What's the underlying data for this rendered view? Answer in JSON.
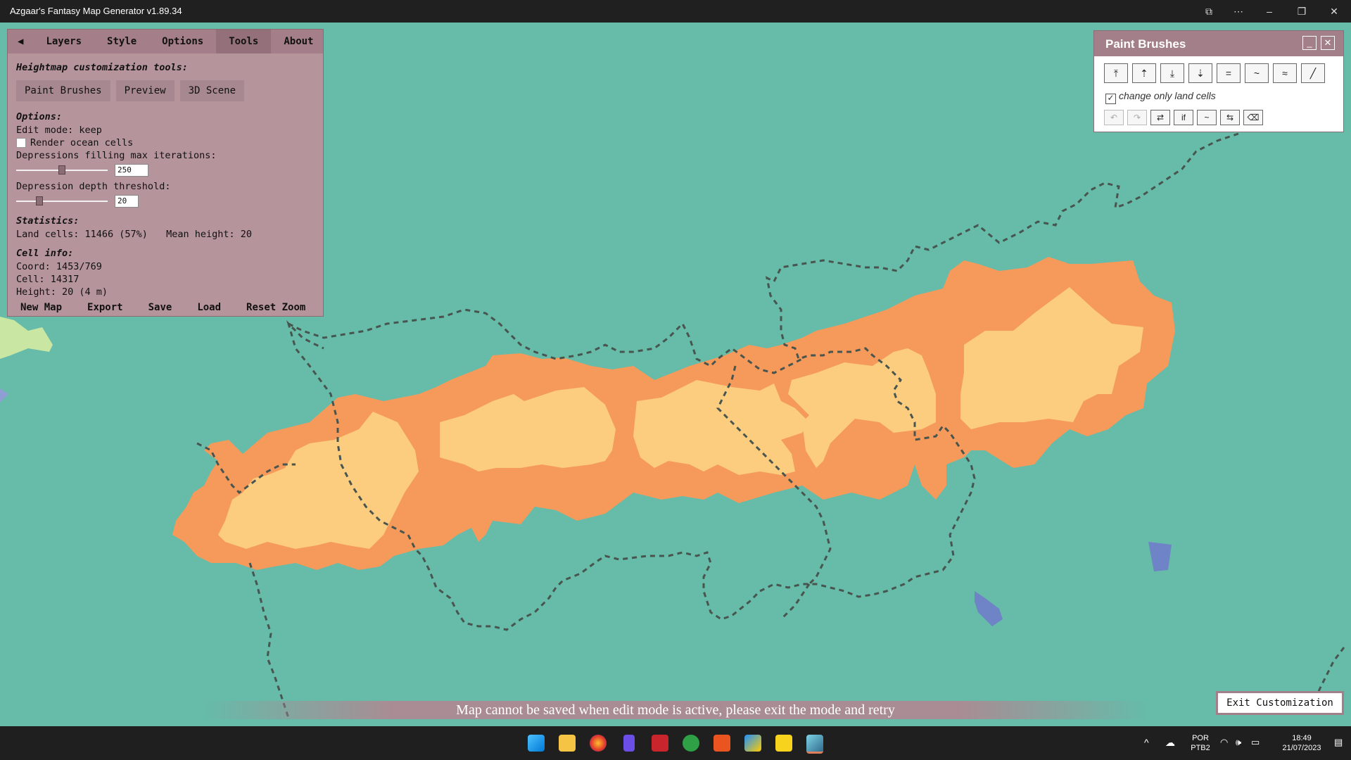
{
  "window": {
    "title": "Azgaar's Fantasy Map Generator v1.89.34"
  },
  "panel": {
    "tabs": [
      "◀",
      "Layers",
      "Style",
      "Options",
      "Tools",
      "About"
    ],
    "active_tab": "Tools",
    "heightmap_title": "Heightmap customization tools:",
    "tool_buttons": [
      "Paint Brushes",
      "Preview",
      "3D Scene"
    ],
    "options_title": "Options:",
    "edit_mode": "Edit mode: keep",
    "render_ocean": "Render ocean cells",
    "depr_iter_label": "Depressions filling max iterations:",
    "depr_iter_value": "250",
    "depr_iter_fraction": 0.5,
    "depr_depth_label": "Depression depth threshold:",
    "depr_depth_value": "20",
    "depr_depth_fraction": 0.25,
    "stats_title": "Statistics:",
    "land_cells": "Land cells: 11466 (57%)",
    "mean_height": "Mean height: 20",
    "cell_info_title": "Cell info:",
    "coord": "Coord: 1453/769",
    "cell": "Cell: 14317",
    "height": "Height: 20 (4 m)",
    "bottom_menu": [
      "New Map",
      "Export",
      "Save",
      "Load",
      "Reset Zoom"
    ]
  },
  "brushes": {
    "title": "Paint Brushes",
    "brush_icons": [
      "raise-icon",
      "elevate-icon",
      "lower-icon",
      "depress-icon",
      "align-icon",
      "smooth-icon",
      "disrupt-icon",
      "line-icon"
    ],
    "brush_glyphs": [
      "⤒",
      "⇡",
      "⤓",
      "⇣",
      "=",
      "~",
      "≈",
      "╱"
    ],
    "change_only_land": "change only land cells",
    "tool_glyphs": [
      "↶",
      "↷",
      "⇄",
      "if",
      "~",
      "⇆",
      "⌫"
    ]
  },
  "tooltip": "Map cannot be saved when edit mode is active, please exit the mode and retry",
  "exit_button": "Exit Customization",
  "tray": {
    "lang1": "POR",
    "lang2": "PTB2",
    "time": "18:49",
    "date": "21/07/2023"
  }
}
